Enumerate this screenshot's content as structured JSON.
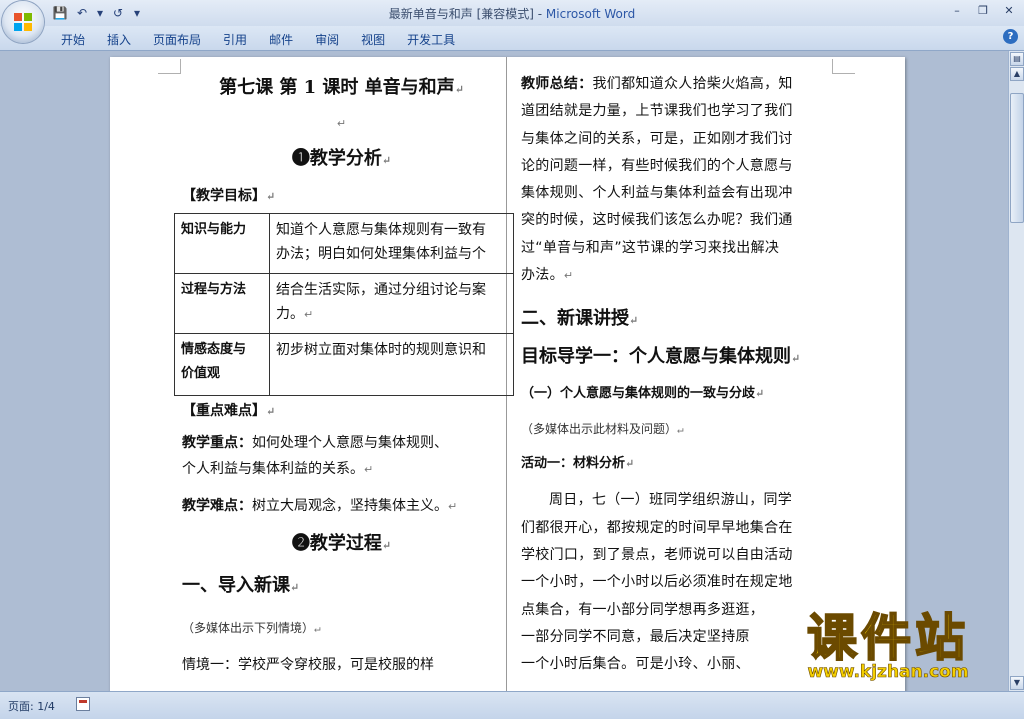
{
  "window": {
    "title_doc": "最新单音与和声 [兼容模式] - ",
    "title_app": "Microsoft Word",
    "controls": [
      "–",
      "❐",
      "✕"
    ]
  },
  "ribbon": {
    "tabs": [
      "开始",
      "插入",
      "页面布局",
      "引用",
      "邮件",
      "审阅",
      "视图",
      "开发工具"
    ],
    "help": "?"
  },
  "doc": {
    "left": {
      "title": "第七课 第 1 课时  单音与和声",
      "sec1": "❶教学分析",
      "goals_heading": "【教学目标】",
      "goals_table": [
        {
          "label": "知识与能力",
          "text1": "知道个人意愿与集体规则有一致有",
          "text2": "办法；明白如何处理集体利益与个"
        },
        {
          "label": "过程与方法",
          "text1": "结合生活实际，通过分组讨论与案",
          "text2": "力。"
        },
        {
          "label1": "情感态度与",
          "label2": "价值观",
          "text1": "初步树立面对集体时的规则意识和",
          "text2": ""
        }
      ],
      "key_heading": "【重点难点】",
      "key_point_label": "教学重点：",
      "key_point_text1": "如何处理个人意愿与集体规则、",
      "key_point_text2": "个人利益与集体利益的关系。",
      "difficult_label": "教学难点：",
      "difficult_text": "树立大局观念，坚持集体主义。",
      "sec2": "❷教学过程",
      "intro_heading": "一、导入新课",
      "intro_note": "（多媒体出示下列情境）",
      "scene1": "情境一：学校严令穿校服，可是校服的样"
    },
    "right": {
      "summary_label": "教师总结：",
      "summary_lines": [
        "我们都知道众人拾柴火焰高，知",
        "道团结就是力量，上节课我们也学习了我们",
        "与集体之间的关系，可是，正如刚才我们讨",
        "论的问题一样，有些时候我们的个人意愿与",
        "集体规则、个人利益与集体利益会有出现冲",
        "突的时候，这时候我们该怎么办呢？我们通",
        "过“单音与和声”这节课的学习来找出解决",
        "办法。"
      ],
      "new_lesson": "二、新课讲授",
      "target1": "目标导学一：个人意愿与集体规则",
      "sub1": "（一）个人意愿与集体规则的一致与分歧",
      "note1": "（多媒体出示此材料及问题）",
      "activity1": "活动一：材料分析",
      "story_lines": [
        "周日，七（一）班同学组织游山，同学",
        "们都很开心，都按规定的时间早早地集合在",
        "学校门口，到了景点，老师说可以自由活动",
        "一个小时，一个小时以后必须准时在规定地",
        "点集合，有一小部分同学想再多逛逛，",
        "一部分同学不同意，最后决定坚持原",
        "一个小时后集合。可是小玲、小丽、"
      ]
    }
  },
  "status": {
    "page": "页面: 1/4"
  },
  "watermark": {
    "main": "课件站",
    "url": "www.kjzhan.com"
  },
  "colors": {
    "background": "#aebdd3",
    "ribbon_text": "#15428b",
    "watermark_fill": "#f5d000"
  }
}
